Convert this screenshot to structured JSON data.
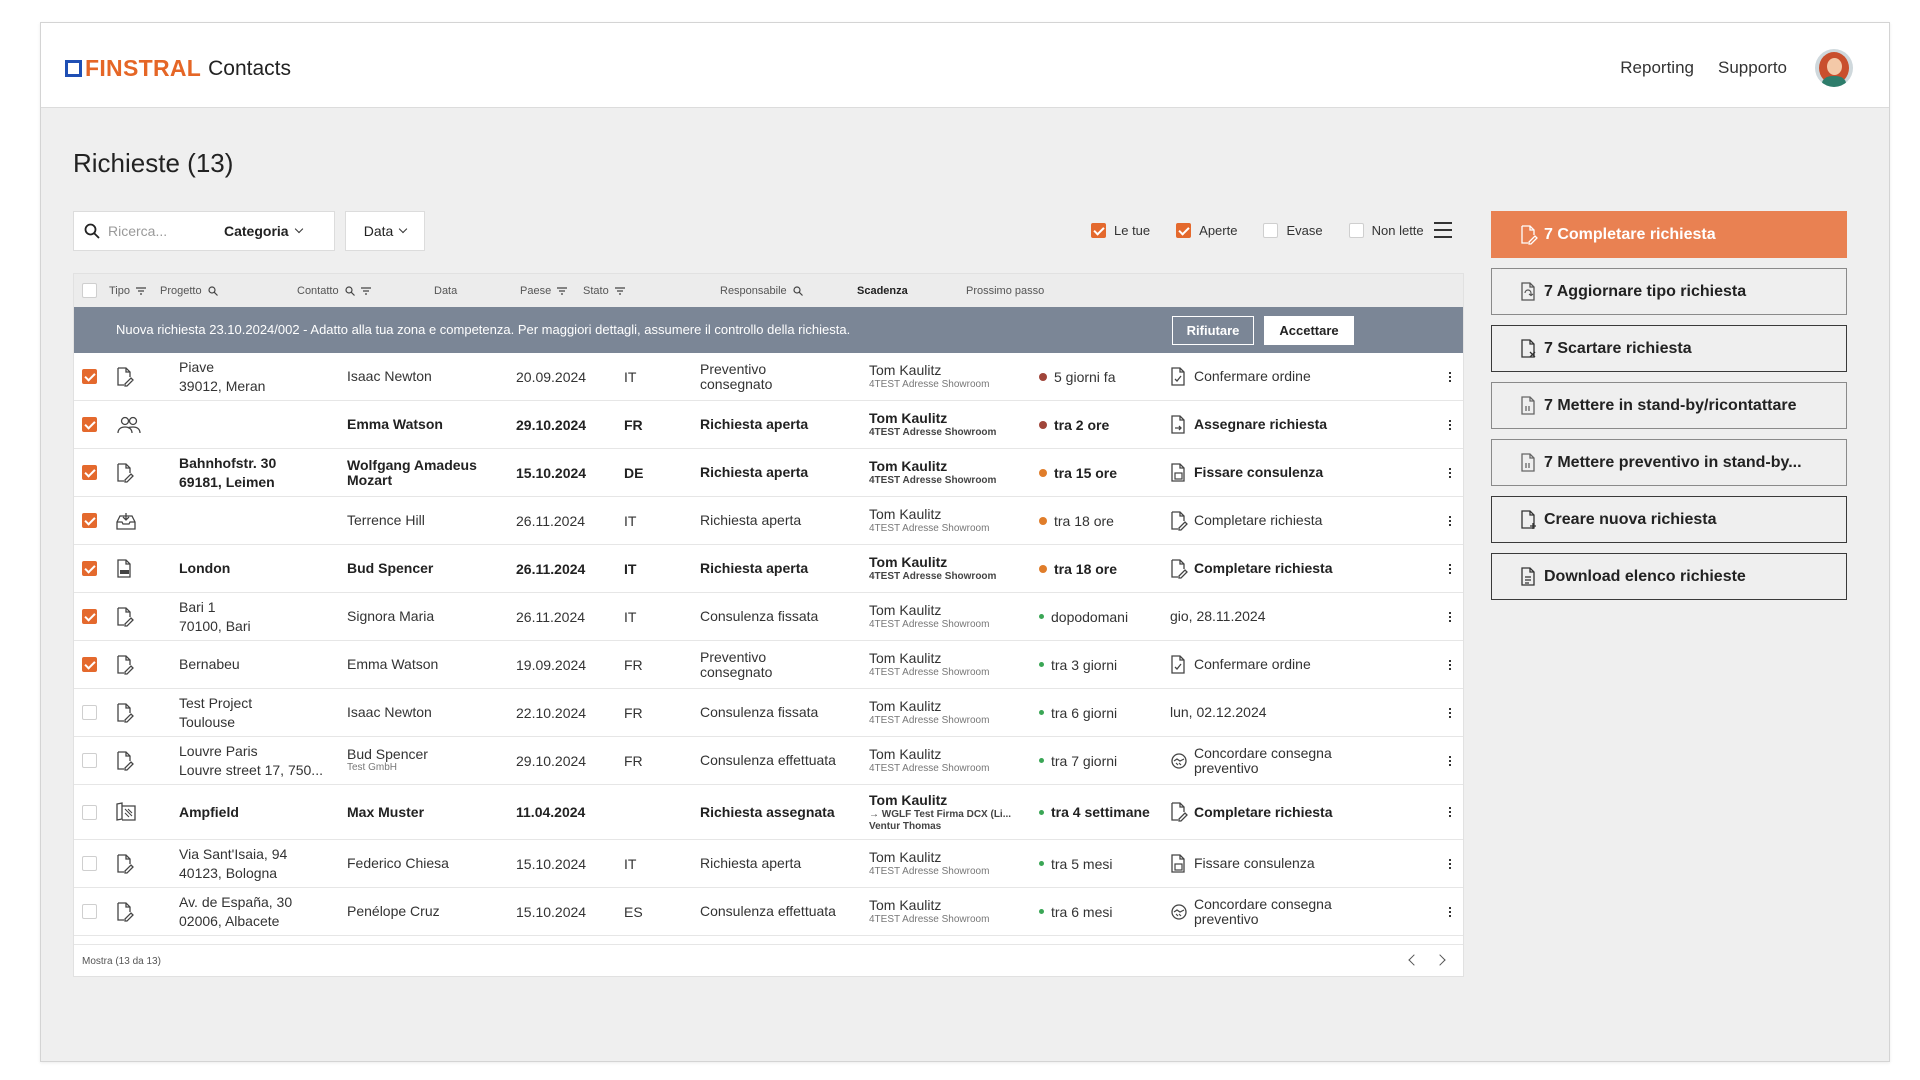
{
  "header": {
    "brand": "FINSTRAL",
    "app_name": "Contacts",
    "nav": [
      "Reporting",
      "Supporto"
    ]
  },
  "page": {
    "title": "Richieste (13)"
  },
  "toolbar": {
    "search_placeholder": "Ricerca...",
    "category_label": "Categoria",
    "date_label": "Data",
    "filters": [
      {
        "label": "Le tue",
        "checked": true
      },
      {
        "label": "Aperte",
        "checked": true
      },
      {
        "label": "Evase",
        "checked": false
      },
      {
        "label": "Non lette",
        "checked": false
      }
    ]
  },
  "table": {
    "columns": [
      "Tipo",
      "Progetto",
      "Contatto",
      "Data",
      "Paese",
      "Stato",
      "Responsabile",
      "Scadenza",
      "Prossimo passo"
    ],
    "notice": {
      "text": "Nuova richiesta 23.10.2024/002 - Adatto alla tua zona e competenza. Per maggiori dettagli, assumere il controllo della richiesta.",
      "reject_label": "Rifiutare",
      "accept_label": "Accettare"
    },
    "rows": [
      {
        "checked": true,
        "bold": false,
        "icon": "document-edit-icon",
        "progetto": [
          "Piave",
          "39012, Meran"
        ],
        "contatto": [
          "Isaac Newton"
        ],
        "data": "20.09.2024",
        "paese": "IT",
        "stato": [
          "Preventivo",
          "consegnato"
        ],
        "resp": "Tom Kaulitz",
        "resp_sub": [
          "4TEST Adresse Showroom"
        ],
        "scadenza": "5 giorni fa",
        "dot": "#a0453a",
        "dot_small": false,
        "next": [
          "Confermare ordine"
        ],
        "next_icon": "document-check-icon"
      },
      {
        "checked": true,
        "bold": true,
        "icon": "group-icon",
        "progetto": [],
        "contatto": [
          "Emma Watson"
        ],
        "data": "29.10.2024",
        "paese": "FR",
        "stato": [
          "Richiesta aperta"
        ],
        "resp": "Tom Kaulitz",
        "resp_sub": [
          "4TEST Adresse Showroom"
        ],
        "scadenza": "tra 2 ore",
        "dot": "#a0453a",
        "dot_small": false,
        "next": [
          "Assegnare richiesta"
        ],
        "next_icon": "document-assign-icon"
      },
      {
        "checked": true,
        "bold": true,
        "icon": "document-edit-icon",
        "progetto": [
          "Bahnhofstr. 30",
          "69181, Leimen"
        ],
        "contatto": [
          "Wolfgang Amadeus",
          "Mozart"
        ],
        "data": "15.10.2024",
        "paese": "DE",
        "stato": [
          "Richiesta aperta"
        ],
        "resp": "Tom Kaulitz",
        "resp_sub": [
          "4TEST Adresse Showroom"
        ],
        "scadenza": "tra 15 ore",
        "dot": "#e07d2a",
        "dot_small": false,
        "next": [
          "Fissare consulenza"
        ],
        "next_icon": "document-calendar-icon"
      },
      {
        "checked": true,
        "bold": false,
        "icon": "inbox-icon",
        "progetto": [],
        "contatto": [
          "Terrence Hill"
        ],
        "data": "26.11.2024",
        "paese": "IT",
        "stato": [
          "Richiesta aperta"
        ],
        "resp": "Tom Kaulitz",
        "resp_sub": [
          "4TEST Adresse Showroom"
        ],
        "scadenza": "tra 18 ore",
        "dot": "#e07d2a",
        "dot_small": false,
        "next": [
          "Completare richiesta"
        ],
        "next_icon": "document-edit-icon"
      },
      {
        "checked": true,
        "bold": true,
        "icon": "dwg-file-icon",
        "progetto": [
          "London"
        ],
        "contatto": [
          "Bud Spencer"
        ],
        "data": "26.11.2024",
        "paese": "IT",
        "stato": [
          "Richiesta aperta"
        ],
        "resp": "Tom Kaulitz",
        "resp_sub": [
          "4TEST Adresse Showroom"
        ],
        "scadenza": "tra 18 ore",
        "dot": "#e07d2a",
        "dot_small": false,
        "next": [
          "Completare richiesta"
        ],
        "next_icon": "document-edit-icon"
      },
      {
        "checked": true,
        "bold": false,
        "icon": "document-edit-icon",
        "progetto": [
          "Bari 1",
          "70100, Bari"
        ],
        "contatto": [
          "Signora Maria"
        ],
        "data": "26.11.2024",
        "paese": "IT",
        "stato": [
          "Consulenza fissata"
        ],
        "resp": "Tom Kaulitz",
        "resp_sub": [
          "4TEST Adresse Showroom"
        ],
        "scadenza": "dopodomani",
        "dot": "#3aa655",
        "dot_small": true,
        "next": [
          "gio, 28.11.2024"
        ],
        "next_icon": ""
      },
      {
        "checked": true,
        "bold": false,
        "icon": "document-edit-icon",
        "progetto": [
          "Bernabeu"
        ],
        "contatto": [
          "Emma Watson"
        ],
        "data": "19.09.2024",
        "paese": "FR",
        "stato": [
          "Preventivo",
          "consegnato"
        ],
        "resp": "Tom Kaulitz",
        "resp_sub": [
          "4TEST Adresse Showroom"
        ],
        "scadenza": "tra 3 giorni",
        "dot": "#3aa655",
        "dot_small": true,
        "next": [
          "Confermare ordine"
        ],
        "next_icon": "document-check-icon"
      },
      {
        "checked": false,
        "bold": false,
        "icon": "document-edit-icon",
        "progetto": [
          "Test Project",
          "Toulouse"
        ],
        "contatto": [
          "Isaac Newton"
        ],
        "data": "22.10.2024",
        "paese": "FR",
        "stato": [
          "Consulenza fissata"
        ],
        "resp": "Tom Kaulitz",
        "resp_sub": [
          "4TEST Adresse Showroom"
        ],
        "scadenza": "tra 6 giorni",
        "dot": "#3aa655",
        "dot_small": true,
        "next": [
          "lun, 02.12.2024"
        ],
        "next_icon": ""
      },
      {
        "checked": false,
        "bold": false,
        "icon": "document-edit-icon",
        "progetto": [
          "Louvre Paris",
          "Louvre street 17, 750..."
        ],
        "contatto": [
          "Bud Spencer"
        ],
        "contatto_sub": "Test GmbH",
        "data": "29.10.2024",
        "paese": "FR",
        "stato": [
          "Consulenza effettuata"
        ],
        "resp": "Tom Kaulitz",
        "resp_sub": [
          "4TEST Adresse Showroom"
        ],
        "scadenza": "tra 7 giorni",
        "dot": "#3aa655",
        "dot_small": true,
        "next": [
          "Concordare consegna",
          "preventivo"
        ],
        "next_icon": "handshake-icon"
      },
      {
        "checked": false,
        "bold": true,
        "tall": true,
        "icon": "blueprint-icon",
        "progetto": [
          "Ampfield"
        ],
        "contatto": [
          "Max Muster"
        ],
        "data": "11.04.2024",
        "paese": "",
        "stato": [
          "Richiesta assegnata"
        ],
        "resp": "Tom Kaulitz",
        "resp_sub": [
          "→ WGLF Test Firma DCX (Li...",
          "Ventur Thomas"
        ],
        "scadenza": "tra 4 settimane",
        "dot": "#3aa655",
        "dot_small": true,
        "next": [
          "Completare richiesta"
        ],
        "next_icon": "document-edit-icon"
      },
      {
        "checked": false,
        "bold": false,
        "icon": "document-edit-icon",
        "progetto": [
          "Via Sant'Isaia, 94",
          "40123, Bologna"
        ],
        "contatto": [
          "Federico Chiesa"
        ],
        "data": "15.10.2024",
        "paese": "IT",
        "stato": [
          "Richiesta aperta"
        ],
        "resp": "Tom Kaulitz",
        "resp_sub": [
          "4TEST Adresse Showroom"
        ],
        "scadenza": "tra 5 mesi",
        "dot": "#3aa655",
        "dot_small": true,
        "next": [
          "Fissare consulenza"
        ],
        "next_icon": "document-calendar-icon"
      },
      {
        "checked": false,
        "bold": false,
        "icon": "document-edit-icon",
        "progetto": [
          "Av. de España, 30",
          "02006, Albacete"
        ],
        "contatto": [
          "Penélope Cruz"
        ],
        "data": "15.10.2024",
        "paese": "ES",
        "stato": [
          "Consulenza effettuata"
        ],
        "resp": "Tom Kaulitz",
        "resp_sub": [
          "4TEST Adresse Showroom"
        ],
        "scadenza": "tra 6 mesi",
        "dot": "#3aa655",
        "dot_small": true,
        "next": [
          "Concordare consegna",
          "preventivo"
        ],
        "next_icon": "handshake-icon"
      }
    ],
    "footer": "Mostra  (13 da 13)"
  },
  "actions": [
    {
      "label": "7 Completare richiesta",
      "style": "primary",
      "icon": "document-edit-icon"
    },
    {
      "label": "7 Aggiornare tipo richiesta",
      "style": "dis",
      "icon": "document-refresh-icon"
    },
    {
      "label": "7 Scartare richiesta",
      "style": "normal",
      "icon": "document-x-icon"
    },
    {
      "label": "7 Mettere in stand-by/ricontattare",
      "style": "dis",
      "icon": "document-pause-icon"
    },
    {
      "label": "7 Mettere preventivo in stand-by...",
      "style": "dis",
      "icon": "document-pause-icon"
    },
    {
      "label": "Creare nuova richiesta",
      "style": "normal",
      "icon": "document-plus-icon"
    },
    {
      "label": "Download elenco richieste",
      "style": "normal",
      "icon": "document-list-icon"
    }
  ],
  "colors": {
    "accent": "#e4692d",
    "brand_orange": "#e56626",
    "brand_blue": "#1f4fb4",
    "notice_bg": "#7b8696",
    "primary_action": "#e98152"
  }
}
